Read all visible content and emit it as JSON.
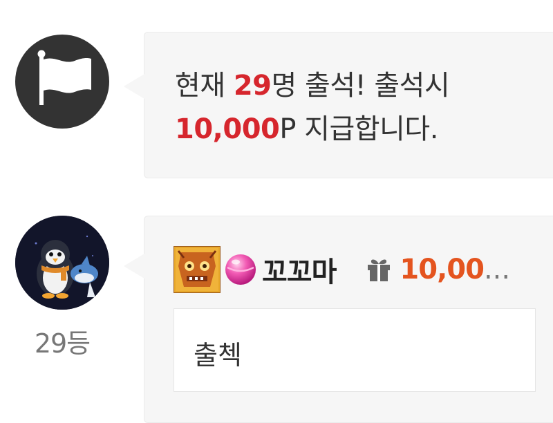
{
  "notice": {
    "icon": "flag-icon",
    "prefix": "현재 ",
    "attendee_count": "29",
    "middle": "명 출석! 출석시",
    "points": "10,000",
    "suffix": "P 지급합니다."
  },
  "comment": {
    "avatar": "penguin-avatar",
    "rank": "29등",
    "level_badge_icon": "level-badge-icon",
    "gem_icon": "pink-gem-icon",
    "nickname": "꼬꼬마",
    "gift_icon": "gift-icon",
    "gift_points": "10,00",
    "gift_ellipsis": "...",
    "text": "출첵"
  },
  "colors": {
    "highlight_red": "#d6262d",
    "gift_orange": "#e4541f",
    "bubble_bg": "#f6f6f6",
    "avatar_dark": "#333333"
  }
}
